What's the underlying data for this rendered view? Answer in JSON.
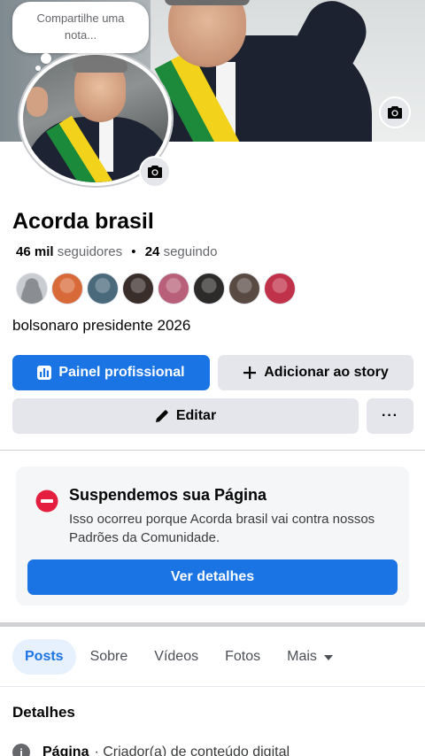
{
  "note": {
    "placeholder": "Compartilhe uma nota..."
  },
  "profile": {
    "name": "Acorda brasil",
    "followers_count": "46 mil",
    "followers_label": "seguidores",
    "separator": "•",
    "following_count": "24",
    "following_label": "seguindo",
    "bio": "bolsonaro presidente 2026"
  },
  "follower_avatars": [
    {
      "color": "#c9ccd1"
    },
    {
      "color": "#d86a3a"
    },
    {
      "color": "#4a6a7c"
    },
    {
      "color": "#3a2e2a"
    },
    {
      "color": "#b8607a"
    },
    {
      "color": "#2d2a2a"
    },
    {
      "color": "#5a4a44"
    },
    {
      "color": "#c0324a"
    }
  ],
  "actions": {
    "dashboard_label": "Painel profissional",
    "add_story_label": "Adicionar ao story",
    "edit_label": "Editar",
    "more_label": "···"
  },
  "alert": {
    "title": "Suspendemos sua Página",
    "text": "Isso ocorreu porque Acorda brasil vai contra nossos Padrões da Comunidade.",
    "button_label": "Ver detalhes",
    "icon": "stop-sign-icon",
    "icon_color": "#e41e3f"
  },
  "tabs": [
    {
      "label": "Posts",
      "active": true
    },
    {
      "label": "Sobre",
      "active": false
    },
    {
      "label": "Vídeos",
      "active": false
    },
    {
      "label": "Fotos",
      "active": false
    },
    {
      "label": "Mais",
      "active": false
    }
  ],
  "details": {
    "title": "Detalhes",
    "row_bold": "Página",
    "row_text": "· Criador(a) de conteúdo digital"
  },
  "colors": {
    "brand_blue": "#1b74e4",
    "secondary_gray": "#e4e6eb"
  }
}
